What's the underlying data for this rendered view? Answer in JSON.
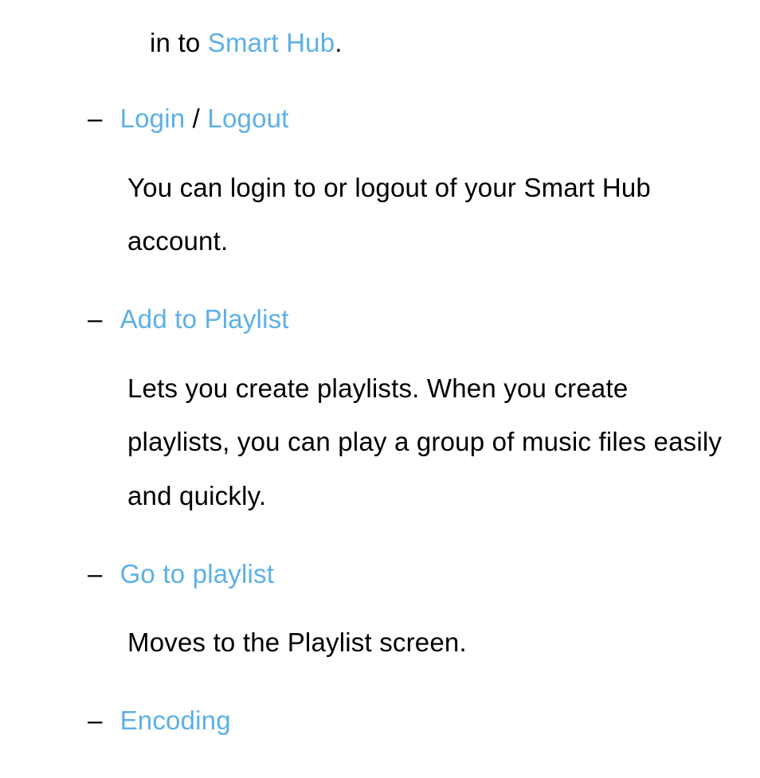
{
  "fragment": {
    "prefix": "in to ",
    "link": "Smart Hub",
    "suffix": "."
  },
  "items": [
    {
      "dash": "–",
      "header": [
        {
          "text": "Login",
          "kind": "term"
        },
        {
          "text": " / ",
          "kind": "sep"
        },
        {
          "text": "Logout",
          "kind": "term"
        }
      ],
      "body": "You can login to or logout of your Smart Hub account."
    },
    {
      "dash": "–",
      "header": [
        {
          "text": "Add to Playlist",
          "kind": "term"
        }
      ],
      "body": "Lets you create playlists. When you create playlists, you can play a group of music files easily and quickly."
    },
    {
      "dash": "–",
      "header": [
        {
          "text": "Go to playlist",
          "kind": "term"
        }
      ],
      "body": "Moves to the Playlist screen."
    },
    {
      "dash": "–",
      "header": [
        {
          "text": "Encoding",
          "kind": "term"
        }
      ],
      "body": ""
    }
  ]
}
